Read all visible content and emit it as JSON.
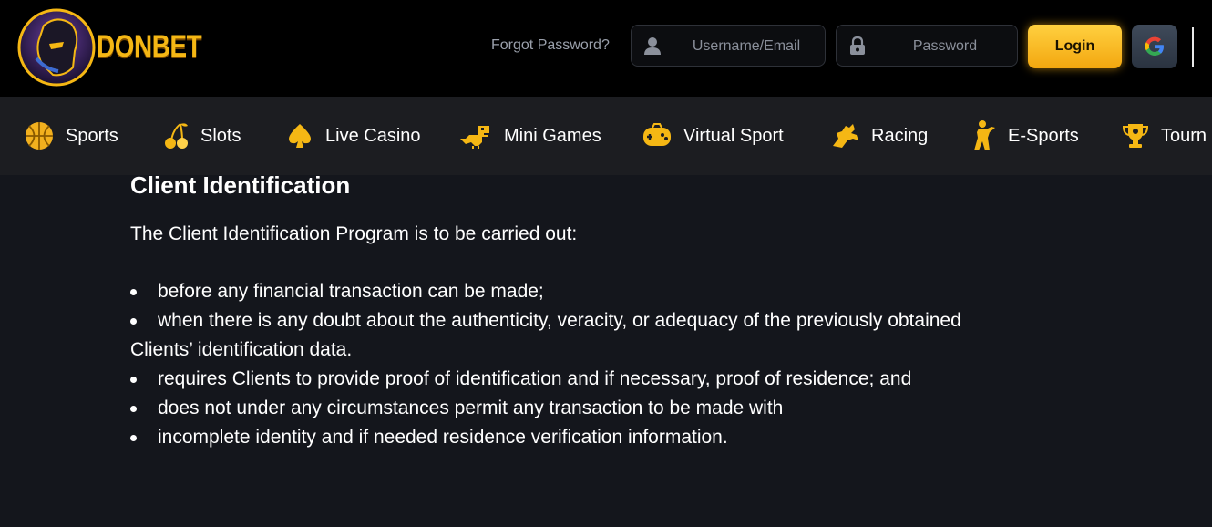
{
  "header": {
    "logo_text": "DONBET",
    "forgot_password": "Forgot Password?",
    "username_placeholder": "Username/Email",
    "password_placeholder": "Password",
    "login_label": "Login",
    "google_icon": "google-icon"
  },
  "nav": {
    "items": [
      {
        "label": "Sports",
        "icon": "basketball-icon"
      },
      {
        "label": "Slots",
        "icon": "cherries-icon"
      },
      {
        "label": "Live Casino",
        "icon": "spade-icon"
      },
      {
        "label": "Mini Games",
        "icon": "dinosaur-icon"
      },
      {
        "label": "Virtual Sport",
        "icon": "gamepad-icon"
      },
      {
        "label": "Racing",
        "icon": "horse-icon"
      },
      {
        "label": "E-Sports",
        "icon": "soldier-icon"
      },
      {
        "label": "Tourn",
        "icon": "trophy-icon"
      }
    ]
  },
  "content": {
    "title": "Client Identification",
    "intro": "The Client Identification Program is to be carried out:",
    "bullets": [
      "before any financial transaction can be made;",
      "when there is any doubt about the authenticity, veracity, or adequacy of the previously obtained",
      "requires Clients to provide proof of identification and if necessary, proof of residence; and",
      "does not under any circumstances permit any transaction to be made with",
      "incomplete identity and if needed residence verification information."
    ],
    "bullet_2_continuation": "Clients’ identification data."
  },
  "colors": {
    "accent": "#f5b714",
    "topbar_bg": "#000000",
    "nav_bg": "#1c1d21",
    "page_bg": "#14161c"
  }
}
